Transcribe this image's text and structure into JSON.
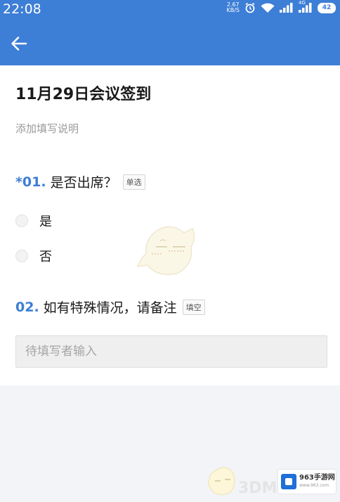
{
  "status_bar": {
    "time": "22:08",
    "net_speed_value": "2.67",
    "net_speed_unit": "KB/S",
    "signal_2_label": "4G",
    "battery": "42"
  },
  "header": {
    "back_icon": "arrow-left-icon"
  },
  "form": {
    "title": "11月29日会议签到",
    "description": "添加填写说明",
    "questions": [
      {
        "number": "*01.",
        "text": "是否出席？",
        "type_tag": "单选",
        "options": [
          "是",
          "否"
        ]
      },
      {
        "number": "02.",
        "text": "如有特殊情况，请备注",
        "type_tag": "填空",
        "placeholder": "待填写者输入"
      }
    ]
  },
  "watermark": {
    "text": "3DM",
    "site_name": "963手游网",
    "site_url": "www.963.com"
  },
  "colors": {
    "accent": "#3d7ed6",
    "page_background": "#f3f4f8",
    "card_background": "#ffffff"
  }
}
